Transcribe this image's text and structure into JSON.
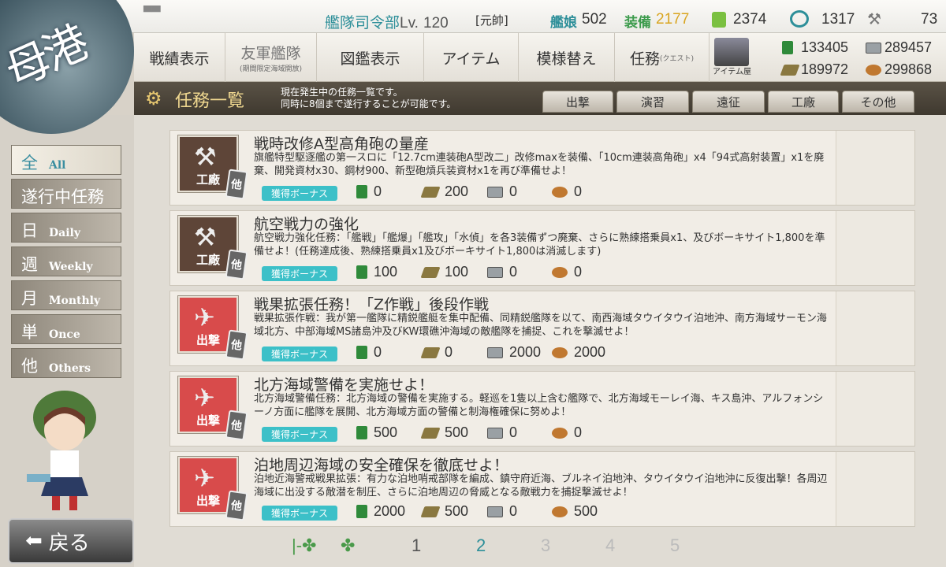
{
  "topbar": {
    "player_name": "▀▀",
    "hq": "艦隊司令部",
    "lv_label": "Lv.",
    "level": "120",
    "rank": "[元帥]",
    "ship_label": "艦娘",
    "ships": "502",
    "equip_label": "装備",
    "equip": "2177",
    "buckets": "2374",
    "dev_materials": "1317",
    "screws": "73"
  },
  "port_label": "母港",
  "nav": [
    {
      "label": "戦績表示",
      "sub": ""
    },
    {
      "label": "友軍艦隊",
      "sub": "(期間限定海域開放)"
    },
    {
      "label": "図鑑表示",
      "sub": ""
    },
    {
      "label": "アイテム",
      "sub": ""
    },
    {
      "label": "模様替え",
      "sub": ""
    },
    {
      "label": "任務",
      "sub": "(クエスト)"
    }
  ],
  "shop_label": "アイテム屋",
  "resources": {
    "fuel": "133405",
    "steel": "289457",
    "ammo": "189972",
    "bauxite": "299868"
  },
  "quest_header": {
    "title": "任務一覧",
    "desc1": "現在発生中の任務一覧です。",
    "desc2": "同時に8個まで遂行することが可能です。"
  },
  "filter_tabs": [
    "出撃",
    "演習",
    "遠征",
    "工廠",
    "その他"
  ],
  "sidebar": [
    {
      "k": "全",
      "e": "All"
    },
    {
      "k": "遂行中任務",
      "e": ""
    },
    {
      "k": "日",
      "e": "Daily"
    },
    {
      "k": "週",
      "e": "Weekly"
    },
    {
      "k": "月",
      "e": "Monthly"
    },
    {
      "k": "単",
      "e": "Once"
    },
    {
      "k": "他",
      "e": "Others"
    }
  ],
  "bonus_label": "獲得ボーナス",
  "other_badge": "他",
  "quests": [
    {
      "cat": "工廠",
      "title": "戦時改修A型高角砲の量産",
      "desc": "旗艦特型駆逐艦の第一スロに「12.7cm連装砲A型改二」改修maxを装備、「10cm連装高角砲」x4「94式高射装置」x1を廃棄、開発資材x30、鋼材900、新型砲熕兵装資材x1を再び準備せよ！",
      "fuel": "0",
      "ammo": "200",
      "steel": "0",
      "baux": "0"
    },
    {
      "cat": "工廠",
      "title": "航空戦力の強化",
      "desc": "航空戦力強化任務：「艦戦」「艦爆」「艦攻」「水偵」を各3装備ずつ廃棄、さらに熟練搭乗員x1、及びボーキサイト1,800を準備せよ！(任務達成後、熟練搭乗員x1及びボーキサイト1,800は消滅します)",
      "fuel": "100",
      "ammo": "100",
      "steel": "0",
      "baux": "0"
    },
    {
      "cat": "出撃",
      "title": "戦果拡張任務！「Z作戦」後段作戦",
      "desc": "戦果拡張作戦：我が第一艦隊に精鋭艦艇を集中配備、同精鋭艦隊を以て、南西海域タウイタウイ泊地沖、南方海域サーモン海域北方、中部海域MS諸島沖及びKW環礁沖海域の敵艦隊を捕捉、これを撃滅せよ！",
      "fuel": "0",
      "ammo": "0",
      "steel": "2000",
      "baux": "2000"
    },
    {
      "cat": "出撃",
      "title": "北方海域警備を実施せよ！",
      "desc": "北方海域警備任務：北方海域の警備を実施する。軽巡を1隻以上含む艦隊で、北方海域モーレイ海、キス島沖、アルフォンシーノ方面に艦隊を展開、北方海域方面の警備と制海権確保に努めよ！",
      "fuel": "500",
      "ammo": "500",
      "steel": "0",
      "baux": "0"
    },
    {
      "cat": "出撃",
      "title": "泊地周辺海域の安全確保を徹底せよ！",
      "desc": "泊地近海警戒戦果拡張：有力な泊地哨戒部隊を編成、鎮守府近海、ブルネイ泊地沖、タウイタウイ泊地沖に反復出撃！各周辺海域に出没する敵潜を制圧、さらに泊地周辺の脅威となる敵戦力を捕捉撃滅せよ！",
      "fuel": "2000",
      "ammo": "500",
      "steel": "0",
      "baux": "500"
    }
  ],
  "pager": {
    "first": "|-✤",
    "prev": "✤",
    "pages": [
      "1",
      "2",
      "3",
      "4",
      "5"
    ],
    "current": "2"
  },
  "back_label": "戻る"
}
